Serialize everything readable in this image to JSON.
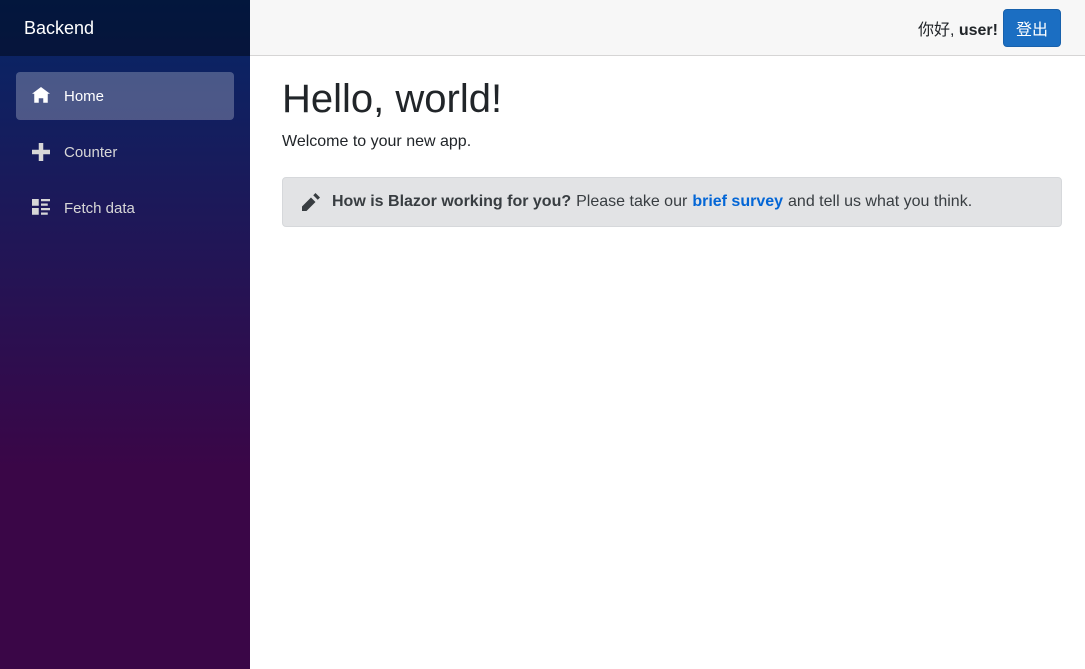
{
  "sidebar": {
    "brand": "Backend",
    "items": [
      {
        "label": "Home",
        "icon": "home-icon",
        "active": true
      },
      {
        "label": "Counter",
        "icon": "plus-icon",
        "active": false
      },
      {
        "label": "Fetch data",
        "icon": "list-rich-icon",
        "active": false
      }
    ]
  },
  "topbar": {
    "greeting_prefix": "你好, ",
    "username": "user!",
    "logout_label": "登出"
  },
  "main": {
    "title": "Hello, world!",
    "subtitle": "Welcome to your new app.",
    "survey": {
      "question": "How is Blazor working for you?",
      "text_before": "Please take our",
      "link": "brief survey",
      "text_after": "and tell us what you think."
    }
  },
  "colors": {
    "accent": "#1b6ec2",
    "link": "#0366d6",
    "sidebar_top": "#052767",
    "sidebar_bottom": "#3a0647"
  }
}
